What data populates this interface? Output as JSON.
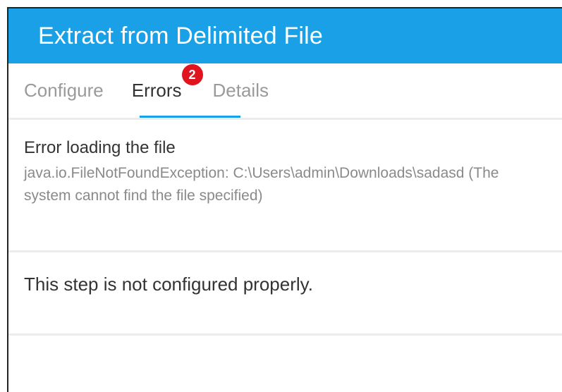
{
  "header": {
    "title": "Extract from Delimited File"
  },
  "tabs": [
    {
      "label": "Configure"
    },
    {
      "label": "Errors",
      "badge": "2"
    },
    {
      "label": "Details"
    }
  ],
  "errors": [
    {
      "title": "Error loading the file",
      "detail": "java.io.FileNotFoundException: C:\\Users\\admin\\Downloads\\sadasd (The system cannot find the file specified)"
    },
    {
      "title": "This step is not configured properly."
    }
  ],
  "colors": {
    "header_bg": "#1aa0e6",
    "badge_bg": "#e0141e",
    "active_tab_underline": "#1aa0e6"
  }
}
